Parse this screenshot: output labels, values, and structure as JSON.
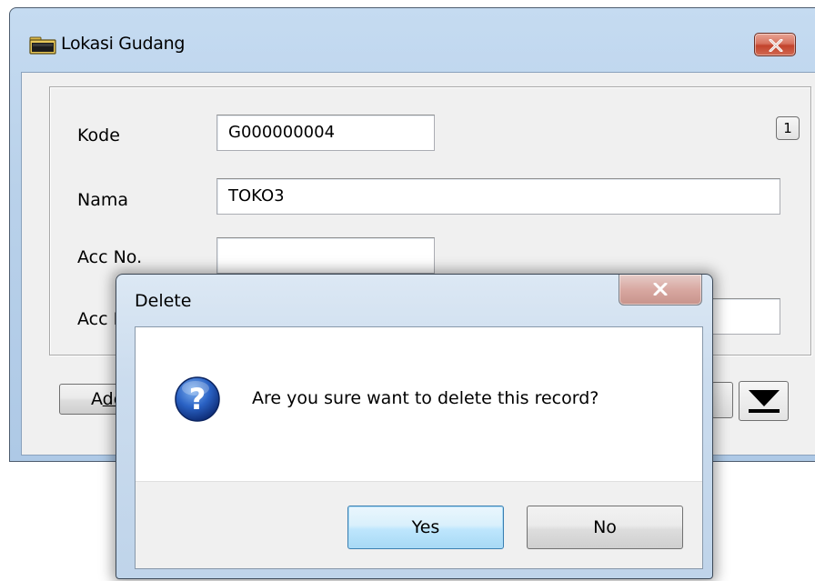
{
  "main_window": {
    "title": "Lokasi Gudang",
    "record_number": "1",
    "fields": {
      "kode_label": "Kode",
      "kode_value": "G000000004",
      "nama_label": "Nama",
      "nama_value": "TOKO3",
      "acc_no_label": "Acc No.",
      "acc_no_value": "",
      "acc_name_label": "Acc N"
    },
    "buttons": {
      "add_prefix": "A",
      "add_underlined": "dd"
    },
    "icons": {
      "title": "folder-icon",
      "close": "close-icon",
      "last_record": "last-record-icon"
    }
  },
  "dialog": {
    "title": "Delete",
    "message": "Are you sure want to delete this record?",
    "yes_label": "Yes",
    "no_label": "No",
    "icon": "question-icon"
  },
  "colors": {
    "titlebar": "#b9d1ea",
    "close_red": "#c2432c",
    "default_button": "#bee6fd"
  }
}
